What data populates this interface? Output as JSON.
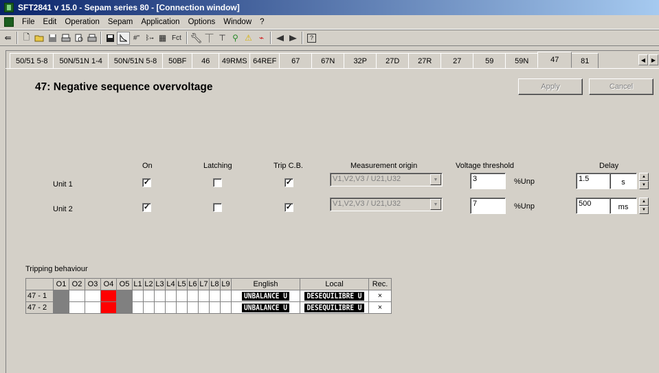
{
  "window": {
    "title": "SFT2841  v 15.0 - Sepam series 80 - [Connection window]"
  },
  "menu": [
    "File",
    "Edit",
    "Operation",
    "Sepam",
    "Application",
    "Options",
    "Window",
    "?"
  ],
  "toolbar_icons": [
    "dock-icon",
    "new-icon",
    "open-icon",
    "save-icon",
    "print-preview-icon",
    "print-setup-icon",
    "print-icon",
    "disk-icon",
    "curve-icon",
    "io-icon",
    "logic-icon",
    "matrix-icon",
    "function-icon",
    "wrench-icon",
    "network-icon",
    "tree-icon",
    "tools-icon",
    "warning-icon",
    "disturbance-icon",
    "send-icon",
    "receive-icon",
    "help-icon"
  ],
  "tabs": [
    {
      "label": "50/51 5-8"
    },
    {
      "label": "50N/51N 1-4"
    },
    {
      "label": "50N/51N 5-8"
    },
    {
      "label": "50BF"
    },
    {
      "label": "46"
    },
    {
      "label": "49RMS"
    },
    {
      "label": "64REF"
    },
    {
      "label": "67"
    },
    {
      "label": "67N"
    },
    {
      "label": "32P"
    },
    {
      "label": "27D"
    },
    {
      "label": "27R"
    },
    {
      "label": "27"
    },
    {
      "label": "59"
    },
    {
      "label": "59N"
    },
    {
      "label": "47"
    },
    {
      "label": "81"
    }
  ],
  "active_tab": "47",
  "page": {
    "title": "47: Negative sequence overvoltage",
    "apply_label": "Apply",
    "cancel_label": "Cancel"
  },
  "columns": {
    "on": "On",
    "latching": "Latching",
    "trip": "Trip C.B.",
    "origin": "Measurement origin",
    "threshold": "Voltage threshold",
    "delay": "Delay"
  },
  "units": [
    {
      "label": "Unit 1",
      "on": true,
      "latching": false,
      "trip": true,
      "origin": "V1,V2,V3 / U21,U32",
      "threshold": "3",
      "threshold_unit": "%Unp",
      "delay": "1.5",
      "delay_unit": "s"
    },
    {
      "label": "Unit 2",
      "on": true,
      "latching": false,
      "trip": true,
      "origin": "V1,V2,V3 / U21,U32",
      "threshold": "7",
      "threshold_unit": "%Unp",
      "delay": "500",
      "delay_unit": "ms"
    }
  ],
  "tripping": {
    "label": "Tripping behaviour",
    "headers": [
      "O1",
      "O2",
      "O3",
      "O4",
      "O5",
      "L1",
      "L2",
      "L3",
      "L4",
      "L5",
      "L6",
      "L7",
      "L8",
      "L9"
    ],
    "english_header": "English",
    "local_header": "Local",
    "rec_header": "Rec.",
    "rows": [
      {
        "name": "47 - 1",
        "cells": [
          "gray",
          "",
          "",
          "red",
          "gray",
          "",
          "",
          "",
          "",
          "",
          "",
          "",
          "",
          ""
        ],
        "english": "UNBALANCE U",
        "local": "DESEQUILIBRE U",
        "rec": "×"
      },
      {
        "name": "47 - 2",
        "cells": [
          "gray",
          "",
          "",
          "red",
          "gray",
          "",
          "",
          "",
          "",
          "",
          "",
          "",
          "",
          ""
        ],
        "english": "UNBALANCE U",
        "local": "DESEQUILIBRE U",
        "rec": "×"
      }
    ]
  },
  "colors": {
    "title_start": "#0a246a",
    "title_end": "#a6caf0",
    "face": "#d4d0c8",
    "output_active": "#ff0000",
    "output_disabled": "#808080"
  }
}
